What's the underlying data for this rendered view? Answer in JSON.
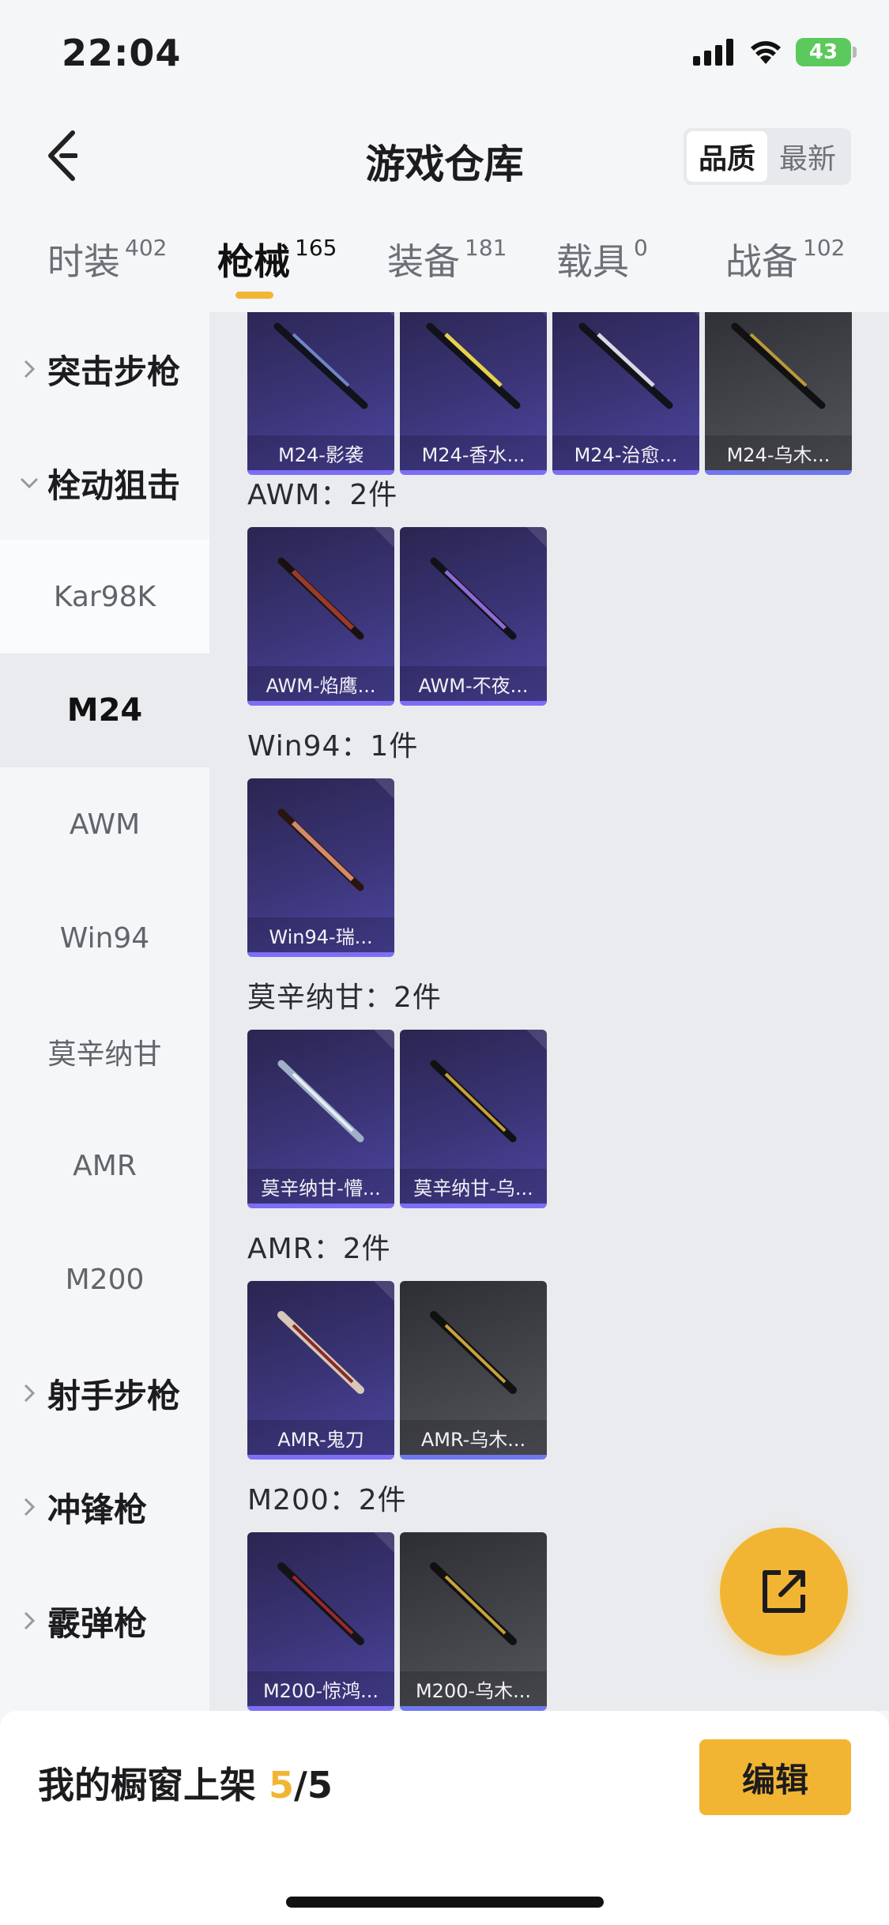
{
  "status_bar": {
    "time": "22:04",
    "battery": "43"
  },
  "header": {
    "title": "游戏仓库",
    "sort_options": [
      "品质",
      "最新"
    ],
    "sort_active": "品质"
  },
  "tabs": [
    {
      "label": "时装",
      "count": "402",
      "active": false
    },
    {
      "label": "枪械",
      "count": "165",
      "active": true
    },
    {
      "label": "装备",
      "count": "181",
      "active": false
    },
    {
      "label": "载具",
      "count": "0",
      "active": false
    },
    {
      "label": "战备",
      "count": "102",
      "active": false
    }
  ],
  "sidebar": {
    "groups": [
      {
        "label": "突击步枪",
        "expanded": false
      },
      {
        "label": "栓动狙击",
        "expanded": true
      },
      {
        "label": "射手步枪",
        "expanded": false
      },
      {
        "label": "冲锋枪",
        "expanded": false
      },
      {
        "label": "霰弹枪",
        "expanded": false
      }
    ],
    "sub_items": [
      "Kar98K",
      "M24",
      "AWM",
      "Win94",
      "莫辛纳甘",
      "AMR",
      "M200"
    ],
    "active_sub": "M24"
  },
  "sections": [
    {
      "title": "",
      "items": [
        {
          "name": "M24-影袭",
          "rarity": "purple"
        },
        {
          "name": "M24-香水...",
          "rarity": "purple"
        },
        {
          "name": "M24-治愈...",
          "rarity": "purple"
        },
        {
          "name": "M24-乌木...",
          "rarity": "gray"
        }
      ]
    },
    {
      "title": "AWM：2件",
      "items": [
        {
          "name": "AWM-焰鹰...",
          "rarity": "purple"
        },
        {
          "name": "AWM-不夜...",
          "rarity": "purple"
        }
      ]
    },
    {
      "title": "Win94：1件",
      "items": [
        {
          "name": "Win94-瑞...",
          "rarity": "purple"
        }
      ]
    },
    {
      "title": "莫辛纳甘：2件",
      "items": [
        {
          "name": "莫辛纳甘-懵...",
          "rarity": "purple"
        },
        {
          "name": "莫辛纳甘-乌...",
          "rarity": "purple"
        }
      ]
    },
    {
      "title": "AMR：2件",
      "items": [
        {
          "name": "AMR-鬼刀",
          "rarity": "purple"
        },
        {
          "name": "AMR-乌木...",
          "rarity": "gray"
        }
      ]
    },
    {
      "title": "M200：2件",
      "items": [
        {
          "name": "M200-惊鸿...",
          "rarity": "purple"
        },
        {
          "name": "M200-乌木...",
          "rarity": "gray"
        }
      ]
    }
  ],
  "bottom": {
    "shelf_label": "我的橱窗上架",
    "shelf_current": "5",
    "shelf_total": "/5",
    "edit_label": "编辑"
  },
  "colors": {
    "accent": "#f2b533",
    "purple_rarity": "#7c6ef5",
    "gray_rarity": "#6f77f0"
  },
  "icons": {
    "back": "back-arrow-icon",
    "share": "share-icon",
    "signal": "signal-icon",
    "wifi": "wifi-icon"
  }
}
